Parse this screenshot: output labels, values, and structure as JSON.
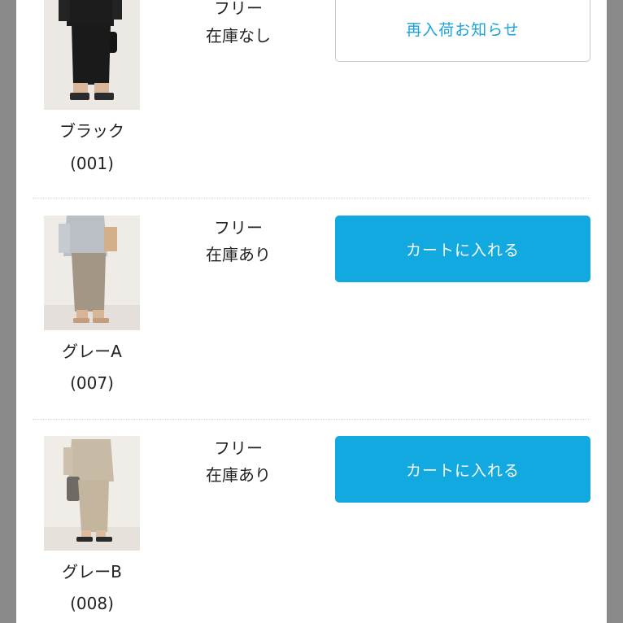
{
  "items": [
    {
      "color_name": "ブラック",
      "color_code": "(001)",
      "size": "フリー",
      "stock": "在庫なし",
      "button_label": "再入荷お知らせ",
      "button_style": "outline"
    },
    {
      "color_name": "グレーA",
      "color_code": "(007)",
      "size": "フリー",
      "stock": "在庫あり",
      "button_label": "カートに入れる",
      "button_style": "primary"
    },
    {
      "color_name": "グレーB",
      "color_code": "(008)",
      "size": "フリー",
      "stock": "在庫あり",
      "button_label": "カートに入れる",
      "button_style": "primary"
    }
  ],
  "colors": {
    "primary_button": "#12a8e0",
    "outline_text": "#1aa3dc",
    "side_background": "#8a8a8a"
  }
}
